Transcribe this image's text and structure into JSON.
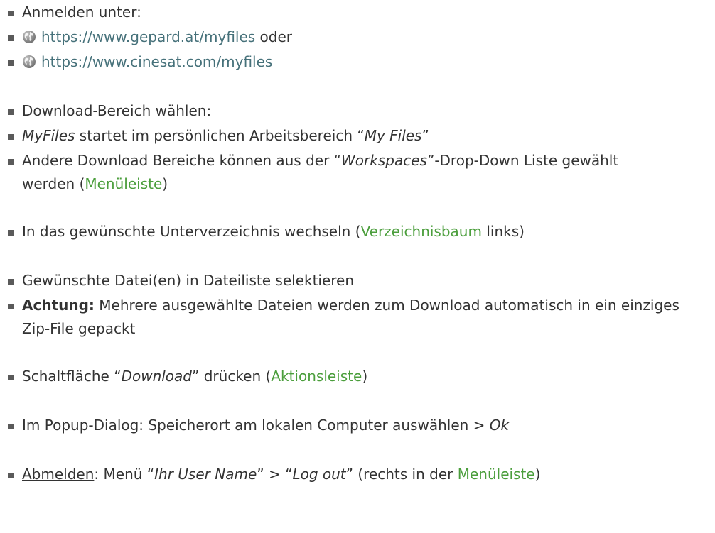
{
  "section_login": {
    "heading": "Anmelden unter:",
    "link1": "https://www.gepard.at/myfiles",
    "link1_suffix": " oder",
    "link2": "https://www.cinesat.com/myfiles"
  },
  "section_area": {
    "heading": "Download-Bereich wählen:",
    "line1_italic": "MyFiles",
    "line1_text": " startet im persönlichen Arbeitsbereich “",
    "line1_italic2": "My Files",
    "line1_end": "”",
    "line2_text": "Andere Download Bereiche können aus der “",
    "line2_italic": "Workspaces",
    "line2_text2": "”-Drop-Down Liste gewählt werden (",
    "line2_link": "Menüleiste",
    "line2_end": ")"
  },
  "section_dir": {
    "text": "In das gewünschte Unterverzeichnis wechseln (",
    "link": "Verzeichnisbaum",
    "end": " links)"
  },
  "section_files": {
    "line1": "Gewünschte Datei(en) in Dateiliste selektieren",
    "warning_label": "Achtung:",
    "warning_text": " Mehrere ausgewählte Dateien werden zum Download automatisch in ein einziges Zip-File gepackt"
  },
  "section_download": {
    "text": "Schaltfläche “",
    "italic": "Download",
    "text2": "” drücken (",
    "link": "Aktionsleiste",
    "end": ")"
  },
  "section_popup": {
    "text": "Im Popup-Dialog: Speicherort am lokalen Computer auswählen > ",
    "italic": "Ok"
  },
  "section_logout": {
    "underlined": "Abmelden",
    "text": ": Menü “",
    "italic1": "Ihr User Name",
    "text2": "” > “",
    "italic2": "Log out",
    "text3": "” (rechts in der ",
    "link": "Menüleiste",
    "end": ")"
  },
  "icons": {
    "bullet": "square-bullet",
    "globe": "globe-icon"
  },
  "colors": {
    "text": "#333333",
    "url_link": "#46717a",
    "green_link": "#4b9e3c"
  }
}
